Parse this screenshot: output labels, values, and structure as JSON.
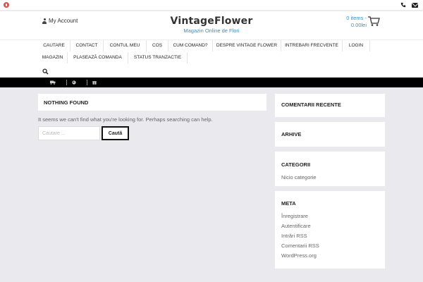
{
  "header": {
    "account_label": "My Account",
    "site_title": "VintageFlower",
    "tagline": "Magazin Online de Flori",
    "cart_items": "0 items -",
    "cart_total": "0.00lei"
  },
  "nav": {
    "items": [
      {
        "label": "CAUTARE"
      },
      {
        "label": "CONTACT"
      },
      {
        "label": "CONTUL MEU"
      },
      {
        "label": "COȘ"
      },
      {
        "label": "CUM COMAND?"
      },
      {
        "label": "DESPRE VINTAGE FLOWER"
      },
      {
        "label": "INTREBARI FRECVENTE"
      },
      {
        "label": "LOGIN"
      },
      {
        "label": "MAGAZIN"
      },
      {
        "label": "PLASEAZĂ COMANDA"
      },
      {
        "label": "STATUS TRANZACTIE"
      }
    ]
  },
  "main": {
    "title": "NOTHING FOUND",
    "message": "It seems we can't find what you're looking for. Perhaps searching can help.",
    "search_placeholder": "Cautare ...",
    "search_button": "Caută"
  },
  "sidebar": {
    "recent_comments_title": "COMENTARII RECENTE",
    "archives_title": "ARHIVE",
    "categories_title": "CATEGORII",
    "no_category": "Nicio categorie",
    "meta_title": "META",
    "meta_links": [
      {
        "label": "Înregistrare"
      },
      {
        "label": "Autentificare"
      },
      {
        "label": "Intrări RSS"
      },
      {
        "label": "Comentarii RSS"
      },
      {
        "label": "WordPress.org"
      }
    ]
  },
  "colors": {
    "accent": "#3a8fc7",
    "page_bg": "#e9e9ee",
    "black_bar": "#000000"
  }
}
